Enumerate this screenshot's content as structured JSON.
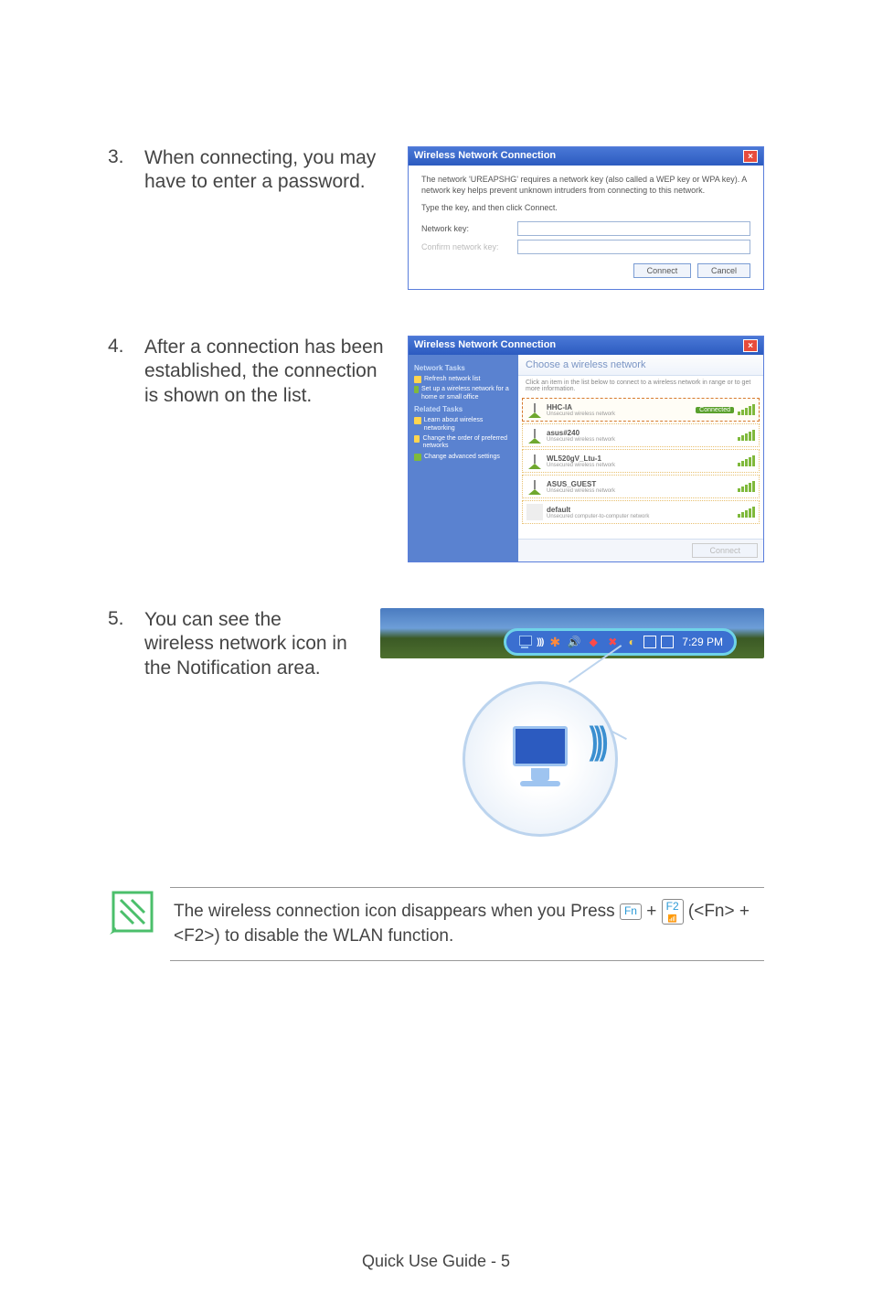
{
  "steps": {
    "s3": {
      "num": "3.",
      "text": "When connecting, you may have to enter a password."
    },
    "s4": {
      "num": "4.",
      "text": "After a connection has been established, the connection is shown on the list."
    },
    "s5": {
      "num": "5.",
      "text": "You can see the wireless network icon in the Notification area."
    }
  },
  "dialog1": {
    "title": "Wireless Network Connection",
    "body": "The network 'UREAPSHG' requires a network key (also called a WEP key or WPA key). A network key helps prevent unknown intruders from connecting to this network.",
    "instruction": "Type the key, and then click Connect.",
    "label1": "Network key:",
    "label2": "Confirm network key:",
    "connect": "Connect",
    "cancel": "Cancel"
  },
  "dialog2": {
    "title": "Wireless Network Connection",
    "side": {
      "hdr1": "Network Tasks",
      "link1": "Refresh network list",
      "link2": "Set up a wireless network for a home or small office",
      "hdr2": "Related Tasks",
      "link3": "Learn about wireless networking",
      "link4": "Change the order of preferred networks",
      "link5": "Change advanced settings"
    },
    "main_hdr": "Choose a wireless network",
    "main_sub": "Click an item in the list below to connect to a wireless network in range or to get more information.",
    "nets": [
      {
        "name": "HHC-IA",
        "sub": "Unsecured wireless network",
        "status": "Connected"
      },
      {
        "name": "asus#240",
        "sub": "Unsecured wireless network",
        "status": ""
      },
      {
        "name": "WL520gV_Ltu-1",
        "sub": "Unsecured wireless network",
        "status": ""
      },
      {
        "name": "ASUS_GUEST",
        "sub": "Unsecured wireless network",
        "status": ""
      },
      {
        "name": "default",
        "sub": "Unsecured computer-to-computer network",
        "status": ""
      }
    ],
    "footer_btn": "Connect"
  },
  "tray": {
    "time": "7:29 PM"
  },
  "note": {
    "part1": "The wireless connection icon disappears when you Press ",
    "key1": "Fn",
    "plus": " + ",
    "key2_top": "F2",
    "key2_bot": "",
    "part2": " (<Fn> + <F2>) to disable the WLAN function."
  },
  "footer": "Quick Use Guide - 5"
}
